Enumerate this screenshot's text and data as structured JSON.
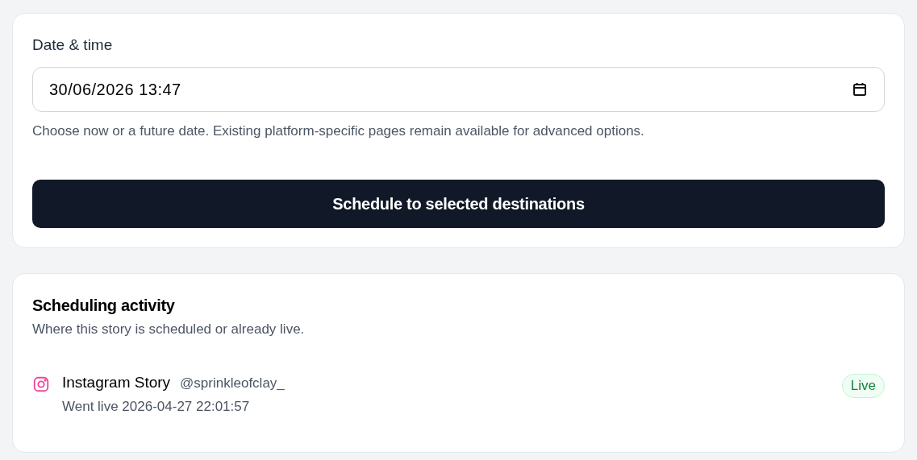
{
  "schedule_form": {
    "label": "Date & time",
    "date_time_value": "30/06/2026 13:47",
    "help_text": "Choose now or a future date. Existing platform-specific pages remain available for advanced options.",
    "submit_button": "Schedule to selected destinations"
  },
  "activity": {
    "title": "Scheduling activity",
    "subtitle": "Where this story is scheduled or already live.",
    "items": [
      {
        "kind": "instagram",
        "name": "Instagram Story",
        "handle": "@sprinkleofclay_",
        "detail": "Went live 2026-04-27 22:01:57",
        "status": {
          "kind": "live",
          "label": "Live"
        }
      }
    ]
  }
}
